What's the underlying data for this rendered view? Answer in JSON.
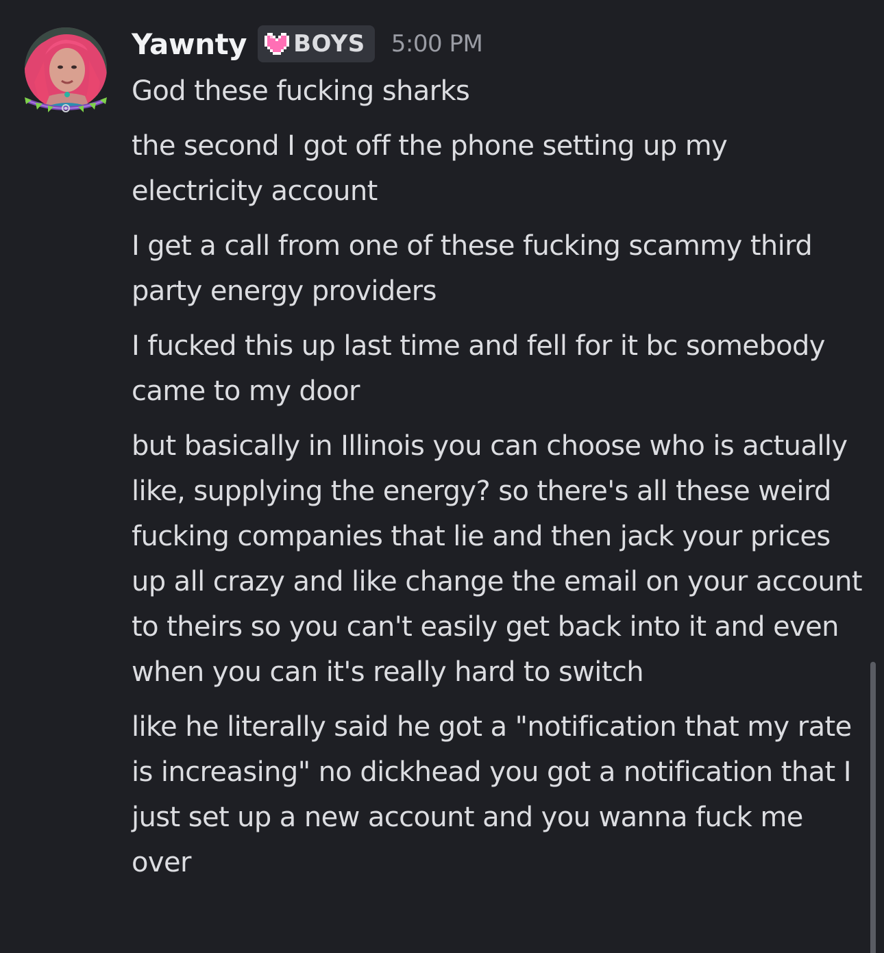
{
  "author": {
    "username": "Yawnty",
    "tag": "BOYS",
    "tag_icon": "pink-pixel-heart-icon",
    "timestamp": "5:00 PM",
    "avatar": "user-avatar"
  },
  "messages": [
    {
      "text": "God these fucking sharks"
    },
    {
      "text": "the second I got off the phone setting up my electricity account"
    },
    {
      "text": "I get a call from one of these fucking scammy third party energy providers"
    },
    {
      "text": "I fucked this up last time and fell for it bc somebody came to my door"
    },
    {
      "text": "but basically in Illinois you can choose who is actually like, supplying the energy? so there's all these weird fucking companies that lie and then jack your prices up all crazy and like change the email on your account to theirs so you can't easily get back into it and even when you can it's really hard to switch"
    },
    {
      "text": "like he literally said he got a \"notification that my rate is increasing\" no dickhead you got a notification that I just set up a new account and you wanna fuck me over"
    }
  ],
  "colors": {
    "background": "#1e1f24",
    "text": "#dcdde1",
    "username": "#f2f3f5",
    "timestamp": "#9a9ca4",
    "tag_bg": "#33353c",
    "heart": "#ff6fb5"
  }
}
